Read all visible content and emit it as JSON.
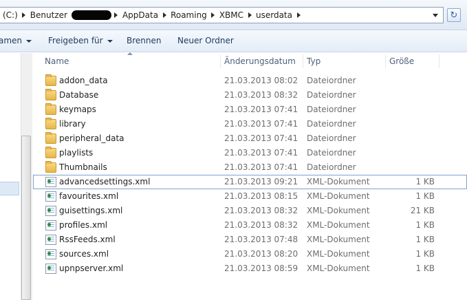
{
  "address": {
    "segments": [
      "(C:)",
      "Benutzer",
      "AppData",
      "Roaming",
      "XBMC",
      "userdata"
    ]
  },
  "toolbar": {
    "organize_label": "amen",
    "share_label": "Freigeben für",
    "burn_label": "Brennen",
    "new_folder_label": "Neuer Ordner"
  },
  "columns": {
    "name": "Name",
    "date": "Änderungsdatum",
    "type": "Typ",
    "size": "Größe"
  },
  "files": [
    {
      "name": "addon_data",
      "date": "21.03.2013 08:02",
      "type": "Dateiordner",
      "size": "",
      "icon": "folder-icon"
    },
    {
      "name": "Database",
      "date": "21.03.2013 08:32",
      "type": "Dateiordner",
      "size": "",
      "icon": "folder-icon"
    },
    {
      "name": "keymaps",
      "date": "21.03.2013 07:41",
      "type": "Dateiordner",
      "size": "",
      "icon": "folder-icon"
    },
    {
      "name": "library",
      "date": "21.03.2013 07:41",
      "type": "Dateiordner",
      "size": "",
      "icon": "folder-icon"
    },
    {
      "name": "peripheral_data",
      "date": "21.03.2013 07:41",
      "type": "Dateiordner",
      "size": "",
      "icon": "folder-icon"
    },
    {
      "name": "playlists",
      "date": "21.03.2013 07:41",
      "type": "Dateiordner",
      "size": "",
      "icon": "folder-icon"
    },
    {
      "name": "Thumbnails",
      "date": "21.03.2013 07:41",
      "type": "Dateiordner",
      "size": "",
      "icon": "folder-icon"
    },
    {
      "name": "advancedsettings.xml",
      "date": "21.03.2013 09:21",
      "type": "XML-Dokument",
      "size": "1 KB",
      "icon": "xml-file-icon"
    },
    {
      "name": "favourites.xml",
      "date": "21.03.2013 08:15",
      "type": "XML-Dokument",
      "size": "1 KB",
      "icon": "xml-file-icon"
    },
    {
      "name": "guisettings.xml",
      "date": "21.03.2013 08:32",
      "type": "XML-Dokument",
      "size": "21 KB",
      "icon": "xml-file-icon"
    },
    {
      "name": "profiles.xml",
      "date": "21.03.2013 08:32",
      "type": "XML-Dokument",
      "size": "1 KB",
      "icon": "xml-file-icon"
    },
    {
      "name": "RssFeeds.xml",
      "date": "21.03.2013 07:48",
      "type": "XML-Dokument",
      "size": "1 KB",
      "icon": "xml-file-icon"
    },
    {
      "name": "sources.xml",
      "date": "21.03.2013 08:20",
      "type": "XML-Dokument",
      "size": "1 KB",
      "icon": "xml-file-icon"
    },
    {
      "name": "upnpserver.xml",
      "date": "21.03.2013 08:59",
      "type": "XML-Dokument",
      "size": "1 KB",
      "icon": "xml-file-icon"
    }
  ],
  "colors": {
    "accent": "#7da2ce",
    "toolbar_text": "#1e395b",
    "header_text": "#4c607a"
  }
}
